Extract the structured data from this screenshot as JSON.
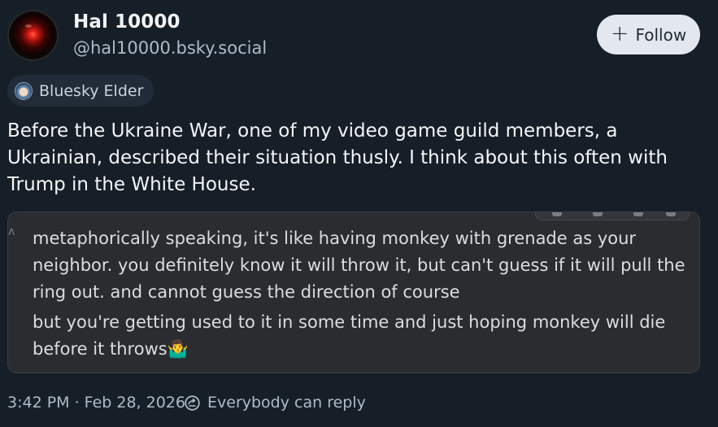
{
  "author": {
    "display_name": "Hal 10000",
    "handle": "@hal10000.bsky.social",
    "avatar_icon": "hal-9000-eye-icon"
  },
  "follow_button": {
    "label": "Follow",
    "icon": "plus-icon"
  },
  "badge": {
    "label": "Bluesky Elder",
    "icon": "elder-badge-icon"
  },
  "post_text": "Before the Ukraine War, one of my video game guild members, a Ukrainian, described their situation thusly. I think about this often with Trump in the White House.",
  "embed_image": {
    "message_1": "metaphorically speaking, it's like having monkey with grenade as your neighbor. you definitely know it will throw it, but can't guess if it will pull the ring out. and cannot guess the direction of course",
    "message_2": "but you're getting used to it in some time and just hoping monkey will die before it throws🤷‍♂️"
  },
  "footer": {
    "timestamp": "3:42 PM · Feb 28, 2026",
    "reply_setting": "Everybody can reply",
    "reply_icon": "reply-settings-icon"
  },
  "colors": {
    "background": "#161e27",
    "primary_text": "#f1f3f5",
    "secondary_text": "#aebbc9",
    "follow_button_bg": "#e3e8ee",
    "badge_bg": "#212c38",
    "embed_bg": "#2b2c30"
  }
}
